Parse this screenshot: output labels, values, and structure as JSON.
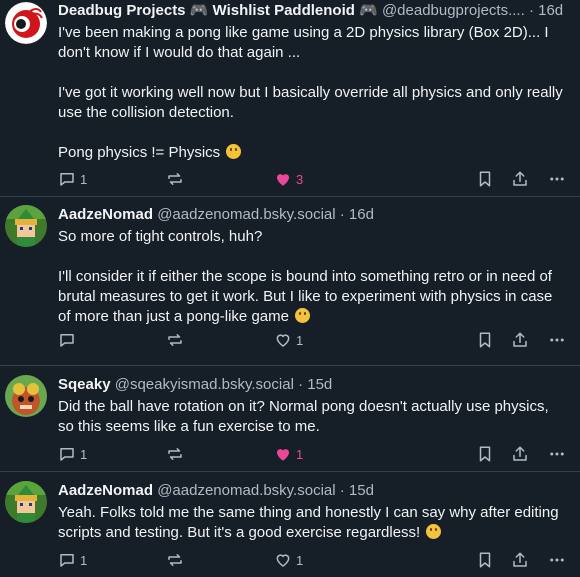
{
  "posts": [
    {
      "author": "Deadbug Projects 🎮 Wishlist Paddlenoid 🎮",
      "handle": "@deadbugprojects....",
      "time": "16d",
      "paragraphs": [
        "I've been making a pong like game using a 2D physics library (Box 2D)... I don't know if I would do that again ...",
        "I've got it working well now but I basically override all physics and only really use the collision detection.",
        "Pong physics != Physics"
      ],
      "reply_count": "1",
      "like_count": "3",
      "liked": true
    },
    {
      "author": "AadzeNomad",
      "handle": "@aadzenomad.bsky.social",
      "time": "16d",
      "paragraphs": [
        "So more of tight controls, huh?",
        "I'll consider it if either the scope is bound into something retro or in need of brutal measures to get it work. But I like to experiment with physics in case of more than just a pong-like game"
      ],
      "reply_count": "",
      "like_count": "1",
      "liked": false
    },
    {
      "author": "Sqeaky",
      "handle": "@sqeakyismad.bsky.social",
      "time": "15d",
      "paragraphs": [
        "Did the ball have rotation on it? Normal pong doesn't actually use physics, so this seems like a fun exercise to me."
      ],
      "reply_count": "1",
      "like_count": "1",
      "liked": true
    },
    {
      "author": "AadzeNomad",
      "handle": "@aadzenomad.bsky.social",
      "time": "15d",
      "paragraphs": [
        "Yeah. Folks told me the same thing and honestly I can say why after editing scripts and testing. But it's a good exercise regardless!"
      ],
      "reply_count": "1",
      "like_count": "1",
      "liked": false
    }
  ],
  "separator": "·",
  "colors": {
    "background": "#161e27",
    "muted": "#aebbc9",
    "like": "#ec4899",
    "divider": "#2e4052"
  }
}
